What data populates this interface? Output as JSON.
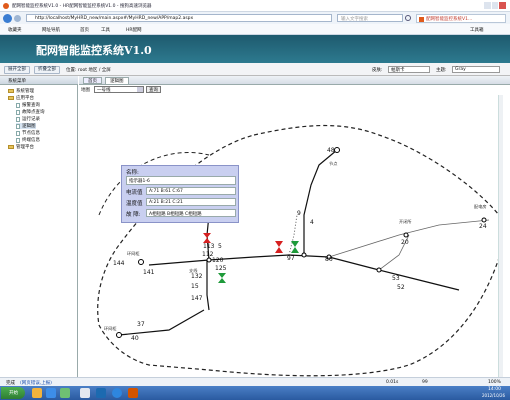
{
  "browser": {
    "title": "配网智能监控系统V1.0 - HR配网智能监控系统V1.0 - 搜狗高速浏览器",
    "url": "http://localhost/MyHRD_new/main.aspx#/MyHRD_new/APP/map2.aspx",
    "search_placeholder": "输入文字搜索",
    "tab_label": "配网智能监控系统V1...",
    "fav_items": [
      "收藏夹",
      "网址导航",
      "首页",
      "工具",
      "HR配网"
    ],
    "toolbox_label": "工具箱",
    "status_done": "完成",
    "status_link": "(网页错误,上报)",
    "speed": "0.01s",
    "ratio": "99",
    "zoom": "100%",
    "clock_time": "14:00",
    "clock_date": "2012/10/26"
  },
  "app": {
    "header_title": "配网智能监控系统V1.0",
    "skin_label": "皮肤:",
    "skin_value": "帕斯卡",
    "theme_label": "主题:",
    "theme_value": "Gray",
    "toolbar": {
      "expand_all": "展开全部",
      "collapse_all": "折叠全部",
      "location": "位置: root 地区 / 全屏"
    },
    "sidebar": {
      "title": "系统菜单",
      "items": [
        {
          "label": "系统管理",
          "type": "folder"
        },
        {
          "label": "应用平台",
          "type": "folder"
        },
        {
          "label": "报警查询",
          "type": "doc"
        },
        {
          "label": "故障点查询",
          "type": "doc"
        },
        {
          "label": "运行记录",
          "type": "doc"
        },
        {
          "label": "逻辑图",
          "type": "doc"
        },
        {
          "label": "节点信息",
          "type": "doc"
        },
        {
          "label": "终端信息",
          "type": "doc"
        },
        {
          "label": "管理平台",
          "type": "folder"
        }
      ]
    },
    "tabs": {
      "home": "首页",
      "active": "逻辑图"
    },
    "map_controls": {
      "label": "地图",
      "line_select": "一号线",
      "query_button": "查询"
    },
    "info_panel": {
      "name_label": "名称:",
      "name_value": "指示器1-6",
      "current_label": "电流值",
      "current_value": "A:71  B:61  C:67",
      "temp_label": "温度值",
      "temp_value": "A:21  B:21  C:21",
      "fault_label": "故 障:",
      "fault_value": "A相短路 B相短路 C相短路"
    },
    "map_numbers": [
      "48",
      "4",
      "9",
      "97",
      "86",
      "20",
      "24",
      "53",
      "52",
      "113",
      "112",
      "120",
      "125",
      "144",
      "141",
      "132",
      "15",
      "147",
      "37",
      "40",
      "5"
    ]
  },
  "taskbar": {
    "start_label": "开始"
  }
}
